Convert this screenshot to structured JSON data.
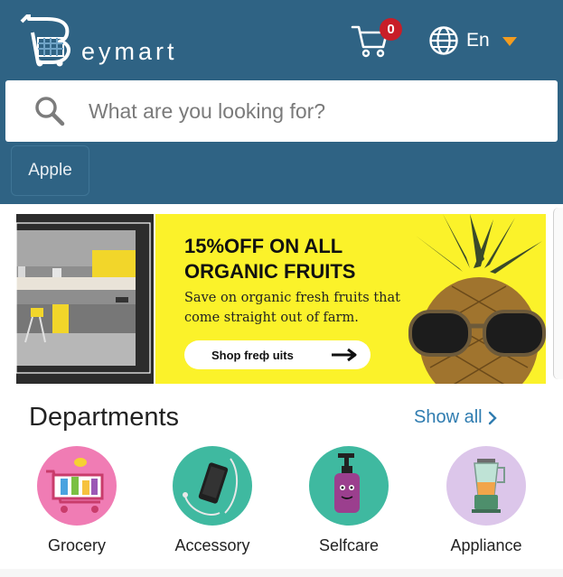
{
  "header": {
    "logo_text": "eymart",
    "cart_count": "0",
    "language": "En",
    "colors": {
      "bar": "#2f6384",
      "badge": "#c81e28",
      "caret": "#f39c1f"
    }
  },
  "search": {
    "placeholder": "What are you looking for?"
  },
  "suggestions": [
    "Apple"
  ],
  "banner": {
    "title_line1": "15%OFF ON ALL",
    "title_line2": "ORGANIC FRUITS",
    "desc_line1": "Save on organic fresh fruits that",
    "desc_line2": "come straight out of farm.",
    "button_label": "Shop freф uits"
  },
  "departments": {
    "title": "Departments",
    "show_all": "Show all",
    "items": [
      {
        "label": "Grocery",
        "color": "#f07cb4",
        "icon": "grocery-cart-icon"
      },
      {
        "label": "Accessory",
        "color": "#3fb9a0",
        "icon": "phone-accessory-icon"
      },
      {
        "label": "Selfcare",
        "color": "#3fb9a0",
        "icon": "selfcare-bottle-icon"
      },
      {
        "label": "Appliance",
        "color": "#dcc6ea",
        "icon": "blender-appliance-icon"
      }
    ]
  }
}
